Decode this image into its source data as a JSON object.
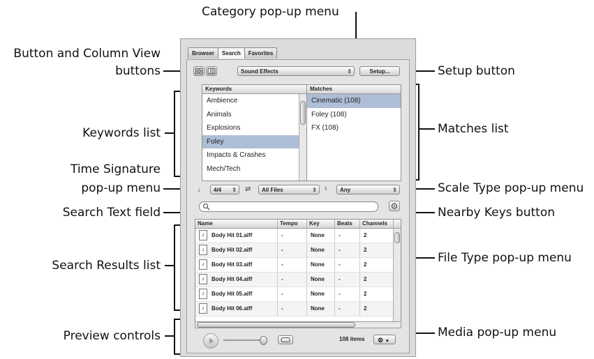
{
  "tabs": [
    "Browser",
    "Search",
    "Favorites"
  ],
  "category_popup": "Sound Effects",
  "setup_label": "Setup...",
  "keywords": {
    "header": "Keywords",
    "items": [
      "Ambience",
      "Animals",
      "Explosions",
      "Foley",
      "Impacts & Crashes",
      "Mech/Tech"
    ],
    "selected": "Foley"
  },
  "matches": {
    "header": "Matches",
    "items": [
      "Cinematic (108)",
      "Foley (108)",
      "FX (108)"
    ],
    "selected": "Cinematic (108)"
  },
  "time_signature_popup": "4/4",
  "file_type_popup": "All Files",
  "scale_type_popup": "Any",
  "results": {
    "columns": [
      "Name",
      "Tempo",
      "Key",
      "Beats",
      "Channels"
    ],
    "rows": [
      [
        "Body Hit 01.aiff",
        "-",
        "None",
        "-",
        "2"
      ],
      [
        "Body Hit 02.aiff",
        "-",
        "None",
        "-",
        "2"
      ],
      [
        "Body Hit 03.aiff",
        "-",
        "None",
        "-",
        "2"
      ],
      [
        "Body Hit 04.aiff",
        "-",
        "None",
        "-",
        "2"
      ],
      [
        "Body Hit 05.aiff",
        "-",
        "None",
        "-",
        "2"
      ],
      [
        "Body Hit 06.aiff",
        "-",
        "None",
        "-",
        "2"
      ]
    ]
  },
  "item_count": "108 items",
  "callouts": {
    "category": "Category pop-up menu",
    "button_column_1": "Button and Column View",
    "button_column_2": "buttons",
    "setup": "Setup button",
    "keywords": "Keywords list",
    "matches": "Matches list",
    "time_sig_1": "Time Signature",
    "time_sig_2": "pop-up menu",
    "scale_type": "Scale Type pop-up menu",
    "search_text": "Search Text field",
    "nearby_keys": "Nearby Keys button",
    "search_results": "Search Results list",
    "file_type": "File Type pop-up menu",
    "preview": "Preview controls",
    "media": "Media pop-up menu"
  }
}
